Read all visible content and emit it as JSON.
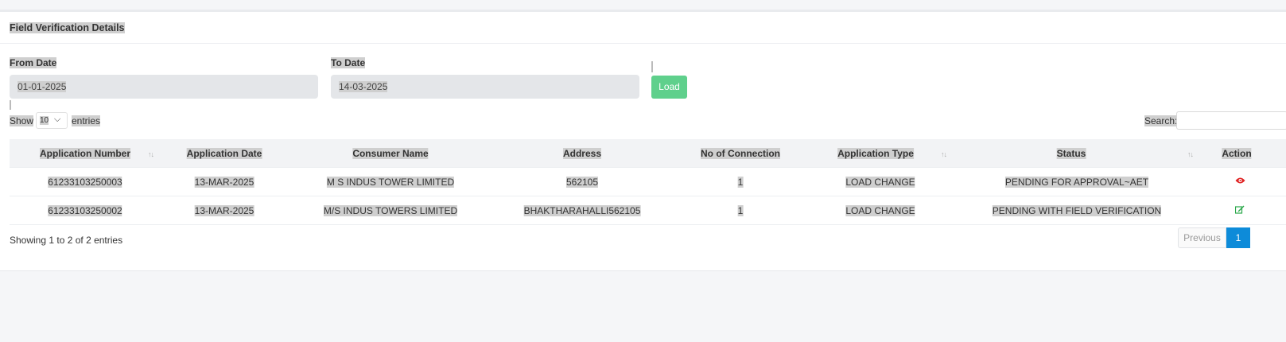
{
  "page": {
    "title": "Field Verification Details"
  },
  "filters": {
    "from_date_label": "From Date",
    "from_date_value": "01-01-2025",
    "to_date_label": "To Date",
    "to_date_value": "14-03-2025",
    "load_label": "Load"
  },
  "table_controls": {
    "show_label": "Show",
    "entries_value": "10",
    "entries_label": "entries",
    "search_label": "Search:"
  },
  "table": {
    "columns": [
      "Application Number",
      "Application Date",
      "Consumer Name",
      "Address",
      "No of Connection",
      "Application Type",
      "Status",
      "Action"
    ],
    "rows": [
      {
        "app_no": "61233103250003",
        "date": "13-MAR-2025",
        "consumer": "M S INDUS TOWER LIMITED",
        "address": "562105",
        "connections": "1",
        "type": "LOAD CHANGE",
        "status": "PENDING FOR APPROVAL~AET",
        "action_icon": "eye-icon"
      },
      {
        "app_no": "61233103250002",
        "date": "13-MAR-2025",
        "consumer": "M/S INDUS TOWERS LIMITED",
        "address": "BHAKTHARAHALLI562105",
        "connections": "1",
        "type": "LOAD CHANGE",
        "status": "PENDING WITH FIELD VERIFICATION",
        "action_icon": "edit-icon"
      }
    ]
  },
  "footer": {
    "showing_text": "Showing 1 to 2 of 2 entries",
    "previous_label": "Previous",
    "page_number": "1"
  },
  "colors": {
    "load_button": "#5fd08c",
    "page_active": "#0d8bd9",
    "eye_icon": "#e02424",
    "edit_icon": "#2aa84a"
  }
}
